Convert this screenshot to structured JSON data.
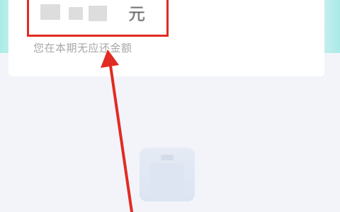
{
  "card": {
    "amount_unit": "元",
    "subtitle": "您在本期无应还金额"
  },
  "colors": {
    "highlight": "#e22b22",
    "subtitle": "#a7a7a7",
    "background": "#f2f4fa"
  },
  "icons": {
    "empty_state": "empty-box-icon",
    "annotation": "red-arrow-icon"
  }
}
